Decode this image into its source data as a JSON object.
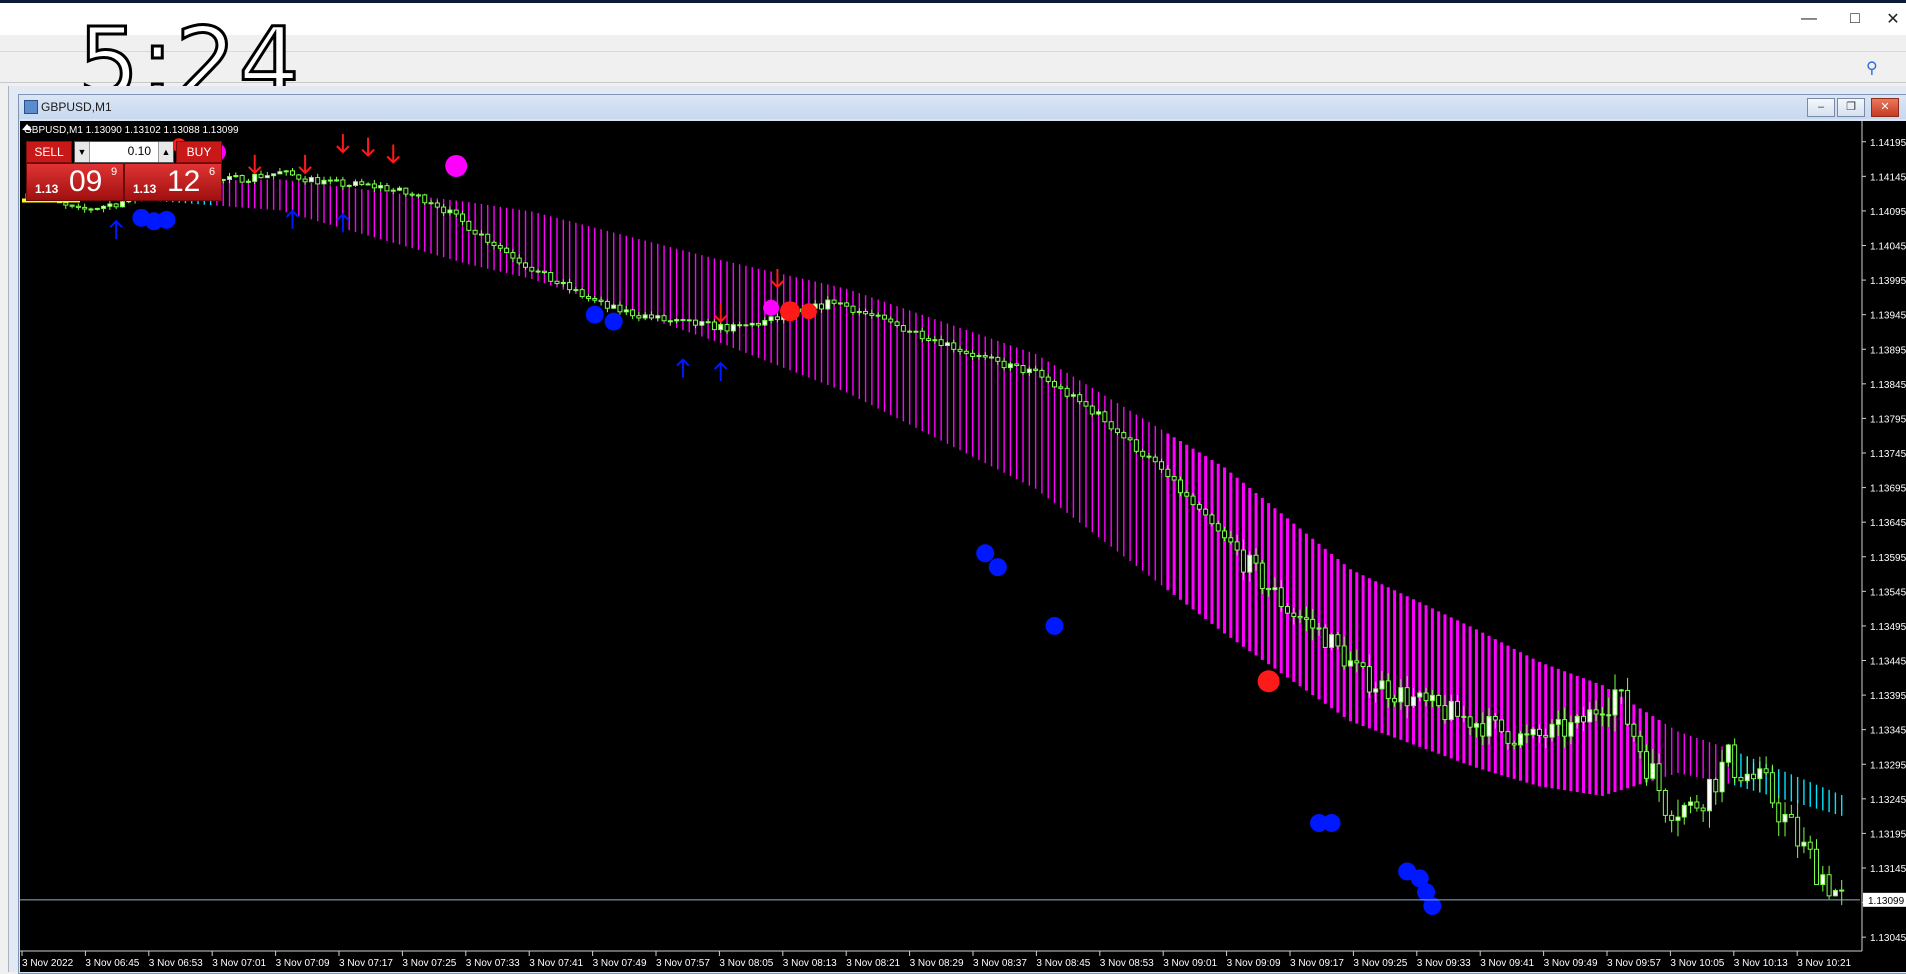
{
  "clock": "5:24",
  "window": {
    "symbol_title": "GBPUSD,M1",
    "ohlc_header": "GBPUSD,M1  1.13090 1.13102 1.13088 1.13099"
  },
  "trade_panel": {
    "sell_label": "SELL",
    "buy_label": "BUY",
    "lot": "0.10",
    "sell_price_small": "1.13",
    "sell_price_big": "09",
    "sell_price_sup": "9",
    "buy_price_small": "1.13",
    "buy_price_big": "12",
    "buy_price_sup": "6"
  },
  "colors": {
    "background": "#000000",
    "bull_candle": "#ffffff",
    "bear_candle": "#7cff4c",
    "ribbon": "#ff00ff",
    "ribbon_start": "#00e5ff",
    "up_arrow": "#0018ff",
    "down_arrow": "#ff1a1a",
    "signal_magenta": "#ff00ff",
    "signal_blue": "#0018ff",
    "signal_red": "#ff1a1a",
    "bid_line": "#8fb0c8",
    "yellow_marker": "#ffff00"
  },
  "chart_data": {
    "type": "candlestick",
    "symbol": "GBPUSD",
    "timeframe": "M1",
    "current_price": "1.13099",
    "ylim": [
      1.13025,
      1.14225
    ],
    "y_ticks": [
      "1.14195",
      "1.14145",
      "1.14095",
      "1.14045",
      "1.13995",
      "1.13945",
      "1.13895",
      "1.13845",
      "1.13795",
      "1.13745",
      "1.13695",
      "1.13645",
      "1.13595",
      "1.13545",
      "1.13495",
      "1.13445",
      "1.13395",
      "1.13345",
      "1.13295",
      "1.13245",
      "1.13195",
      "1.13145",
      "1.13095",
      "1.13045"
    ],
    "x_ticks": [
      "3 Nov 2022",
      "3 Nov 06:45",
      "3 Nov 06:53",
      "3 Nov 07:01",
      "3 Nov 07:09",
      "3 Nov 07:17",
      "3 Nov 07:25",
      "3 Nov 07:33",
      "3 Nov 07:41",
      "3 Nov 07:49",
      "3 Nov 07:57",
      "3 Nov 08:05",
      "3 Nov 08:13",
      "3 Nov 08:21",
      "3 Nov 08:29",
      "3 Nov 08:37",
      "3 Nov 08:45",
      "3 Nov 08:53",
      "3 Nov 09:01",
      "3 Nov 09:09",
      "3 Nov 09:17",
      "3 Nov 09:25",
      "3 Nov 09:33",
      "3 Nov 09:41",
      "3 Nov 09:49",
      "3 Nov 09:57",
      "3 Nov 10:05",
      "3 Nov 10:13",
      "3 Nov 10:21"
    ],
    "price_path": [
      [
        0,
        1.1412
      ],
      [
        8,
        1.14095
      ],
      [
        16,
        1.1411
      ],
      [
        24,
        1.14135
      ],
      [
        32,
        1.1414
      ],
      [
        40,
        1.1415
      ],
      [
        48,
        1.14135
      ],
      [
        56,
        1.1413
      ],
      [
        64,
        1.1411
      ],
      [
        72,
        1.1406
      ],
      [
        82,
        1.14
      ],
      [
        92,
        1.13955
      ],
      [
        102,
        1.13935
      ],
      [
        112,
        1.13925
      ],
      [
        122,
        1.13945
      ],
      [
        128,
        1.13965
      ],
      [
        136,
        1.13935
      ],
      [
        144,
        1.1391
      ],
      [
        152,
        1.1388
      ],
      [
        160,
        1.1386
      ],
      [
        170,
        1.138
      ],
      [
        180,
        1.1372
      ],
      [
        190,
        1.1362
      ],
      [
        200,
        1.1352
      ],
      [
        206,
        1.1348
      ],
      [
        212,
        1.1342
      ],
      [
        222,
        1.1338
      ],
      [
        232,
        1.1335
      ],
      [
        238,
        1.1333
      ],
      [
        246,
        1.1335
      ],
      [
        252,
        1.134
      ],
      [
        260,
        1.1324
      ],
      [
        264,
        1.1323
      ],
      [
        270,
        1.133
      ],
      [
        276,
        1.1326
      ],
      [
        282,
        1.1317
      ],
      [
        288,
        1.13099
      ]
    ],
    "ribbon_center_path": [
      [
        0,
        1.1413
      ],
      [
        40,
        1.14125
      ],
      [
        80,
        1.1406
      ],
      [
        130,
        1.1393
      ],
      [
        160,
        1.1382
      ],
      [
        190,
        1.1364
      ],
      [
        210,
        1.135
      ],
      [
        240,
        1.1338
      ],
      [
        270,
        1.133
      ],
      [
        288,
        1.1324
      ]
    ],
    "ribbon_width_path": [
      [
        0,
        0.0001
      ],
      [
        40,
        0.00045
      ],
      [
        70,
        0.0009
      ],
      [
        110,
        0.0012
      ],
      [
        150,
        0.0018
      ],
      [
        190,
        0.0024
      ],
      [
        230,
        0.002
      ],
      [
        250,
        0.0016
      ],
      [
        262,
        0.0006
      ],
      [
        288,
        0.0003
      ]
    ]
  }
}
